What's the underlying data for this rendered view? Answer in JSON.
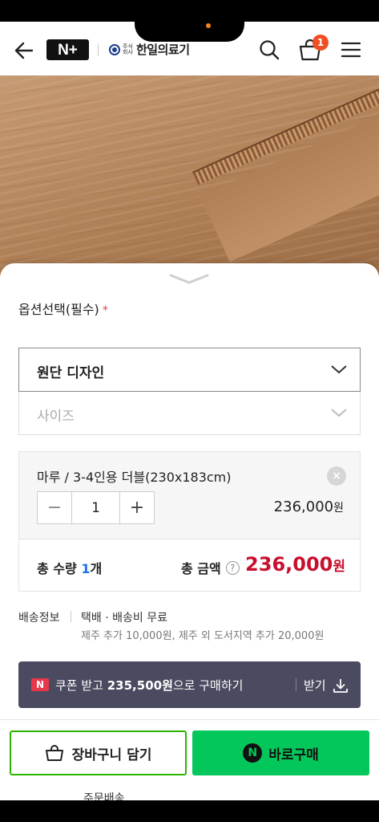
{
  "header": {
    "logo_text": "N+",
    "brand_sub": "주식회사",
    "brand_name": "한일의료기",
    "cart_count": "1"
  },
  "sheet": {
    "option_title": "옵션선택(필수)",
    "required_mark": "*",
    "select_design": "원단 디자인",
    "select_size": "사이즈",
    "chosen_item": {
      "name": "마루 / 3-4인용 더블(230x183cm)",
      "remove_label": "×",
      "quantity": "1",
      "minus": "−",
      "plus": "+",
      "price": "236,000",
      "price_unit": "원"
    },
    "total": {
      "qty_prefix": "총 수량 ",
      "qty_num": "1",
      "qty_suffix": "개",
      "amount_label": "총 금액",
      "help": "?",
      "amount": "236,000",
      "amount_unit": "원"
    },
    "shipping": {
      "label": "배송정보",
      "method": "택배 · 배송비 무료",
      "extra": "제주 추가 10,000원, 제주 외 도서지역 추가 20,000원"
    },
    "coupon": {
      "badge": "N",
      "text_prefix": "쿠폰 받고 ",
      "text_amount": "235,500원",
      "text_suffix": "으로 구매하기",
      "get_label": "받기"
    },
    "buttons": {
      "cart": "장바구니 담기",
      "buy": "바로구매",
      "buy_badge": "N"
    },
    "peek_text": "주문배송"
  },
  "colors": {
    "naver_green": "#03c75a",
    "price_red": "#c8102e",
    "badge_orange": "#f04e23",
    "coupon_bg": "#4a4a60"
  }
}
